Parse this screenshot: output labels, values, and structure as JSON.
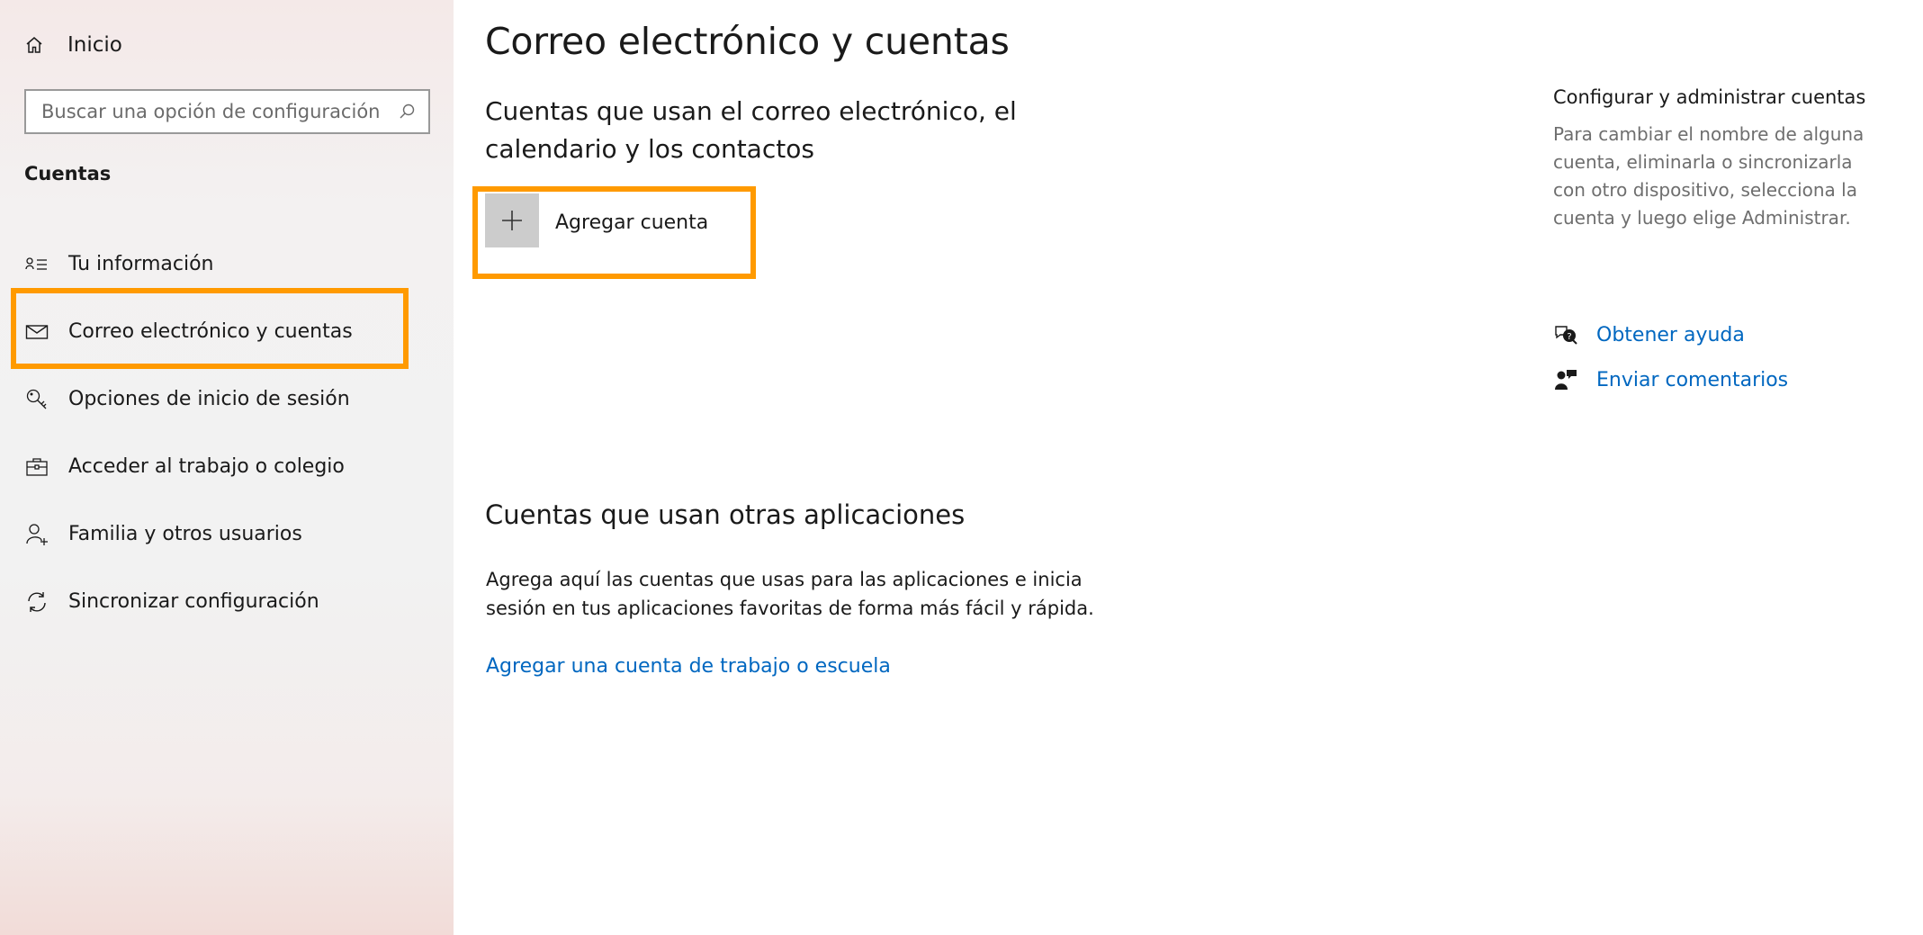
{
  "sidebar": {
    "home": {
      "label": "Inicio",
      "icon": "home-icon"
    },
    "search": {
      "placeholder": "Buscar una opción de configuración",
      "icon": "search-icon"
    },
    "section_title": "Cuentas",
    "items": [
      {
        "label": "Tu información",
        "icon": "person-info-icon",
        "selected": false
      },
      {
        "label": "Correo electrónico y cuentas",
        "icon": "mail-icon",
        "selected": true
      },
      {
        "label": "Opciones de inicio de sesión",
        "icon": "key-icon",
        "selected": false
      },
      {
        "label": "Acceder al trabajo o colegio",
        "icon": "briefcase-icon",
        "selected": false
      },
      {
        "label": "Familia y otros usuarios",
        "icon": "add-person-icon",
        "selected": false
      },
      {
        "label": "Sincronizar configuración",
        "icon": "sync-icon",
        "selected": false
      }
    ]
  },
  "main": {
    "title": "Correo electrónico y cuentas",
    "email_section": {
      "heading": "Cuentas que usan el correo electrónico, el calendario y los contactos",
      "add_account_label": "Agregar cuenta"
    },
    "apps_section": {
      "heading": "Cuentas que usan otras aplicaciones",
      "description": "Agrega aquí las cuentas que usas para las aplicaciones e inicia sesión en tus aplicaciones favoritas de forma más fácil y rápida.",
      "link": "Agregar una cuenta de trabajo o escuela"
    }
  },
  "right_panel": {
    "title": "Configurar y administrar cuentas",
    "description": "Para cambiar el nombre de alguna cuenta, eliminarla o sincronizarla con otro dispositivo, selecciona la cuenta y luego elige Administrar.",
    "links": [
      {
        "label": "Obtener ayuda",
        "icon": "help-chat-icon"
      },
      {
        "label": "Enviar comentarios",
        "icon": "feedback-icon"
      }
    ]
  },
  "colors": {
    "accent": "#0078d4",
    "link": "#0067c0",
    "highlight": "#ff9a00"
  }
}
